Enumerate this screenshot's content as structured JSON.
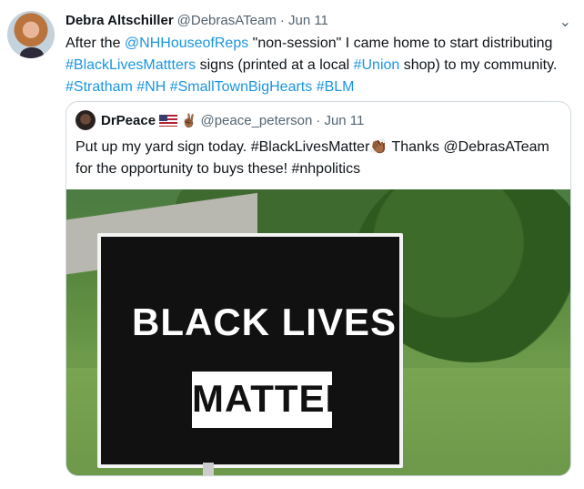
{
  "tweet": {
    "name": "Debra Altschiller",
    "handle": "@DebrasATeam",
    "time": "· Jun 11",
    "caret": "⌄",
    "text": {
      "part1": "After the ",
      "link1": "@NHHouseofReps",
      "part2": " \"non-session\" I came home to start distributing ",
      "link2": "#BlackLivesMattters",
      "part3": " signs (printed at a local ",
      "link3": "#Union",
      "part4": " shop) to my community. ",
      "link4": "#Stratham",
      "link5": "#NH",
      "link6": "#SmallTownBigHearts",
      "link7": "#BLM"
    }
  },
  "quote": {
    "name": "DrPeace",
    "emoji_hand": "✌🏾",
    "handle": "@peace_peterson",
    "time": "· Jun 11",
    "text_part1": "Put up my yard sign today. #BlackLivesMatter",
    "text_emoji": "👏🏾",
    "text_part2": " Thanks @DebrasATeam for the opportunity to buys these! #nhpolitics",
    "sign": {
      "line1": "BLACK LIVES",
      "line2": "MATTER"
    }
  },
  "colors": {
    "link": "#1b95e0",
    "border": "#cfd9de",
    "meta": "#536471"
  }
}
